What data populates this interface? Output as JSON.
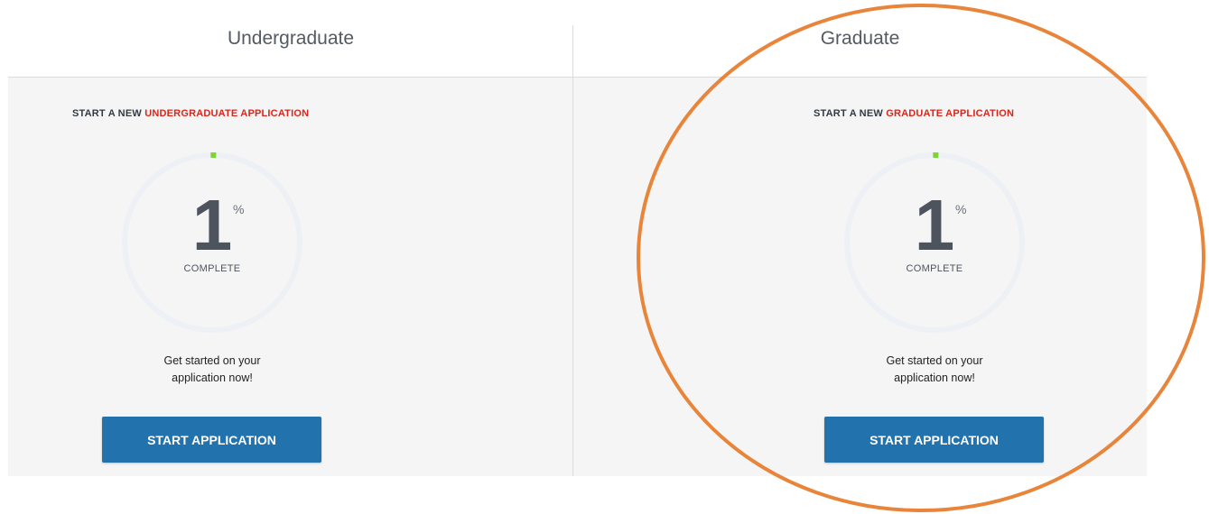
{
  "tabs": [
    {
      "label": "Undergraduate",
      "heading_prefix": "START A NEW ",
      "heading_accent": "UNDERGRADUATE APPLICATION",
      "progress_percent": 1,
      "percent_value": "1",
      "percent_sign": "%",
      "complete_label": "COMPLETE",
      "message_line1": "Get started on your",
      "message_line2": "application now!",
      "button_label": "START APPLICATION"
    },
    {
      "label": "Graduate",
      "heading_prefix": "START A NEW ",
      "heading_accent": "GRADUATE APPLICATION",
      "progress_percent": 1,
      "percent_value": "1",
      "percent_sign": "%",
      "complete_label": "COMPLETE",
      "message_line1": "Get started on your",
      "message_line2": "application now!",
      "button_label": "START APPLICATION"
    }
  ],
  "colors": {
    "accent_red": "#d9261c",
    "button_blue": "#2272ae",
    "progress_green": "#7ed23a",
    "ring_track": "#edf1f5",
    "highlight_orange": "#e8853a"
  },
  "icons": {
    "progress_ring": "circular-progress-ring"
  }
}
